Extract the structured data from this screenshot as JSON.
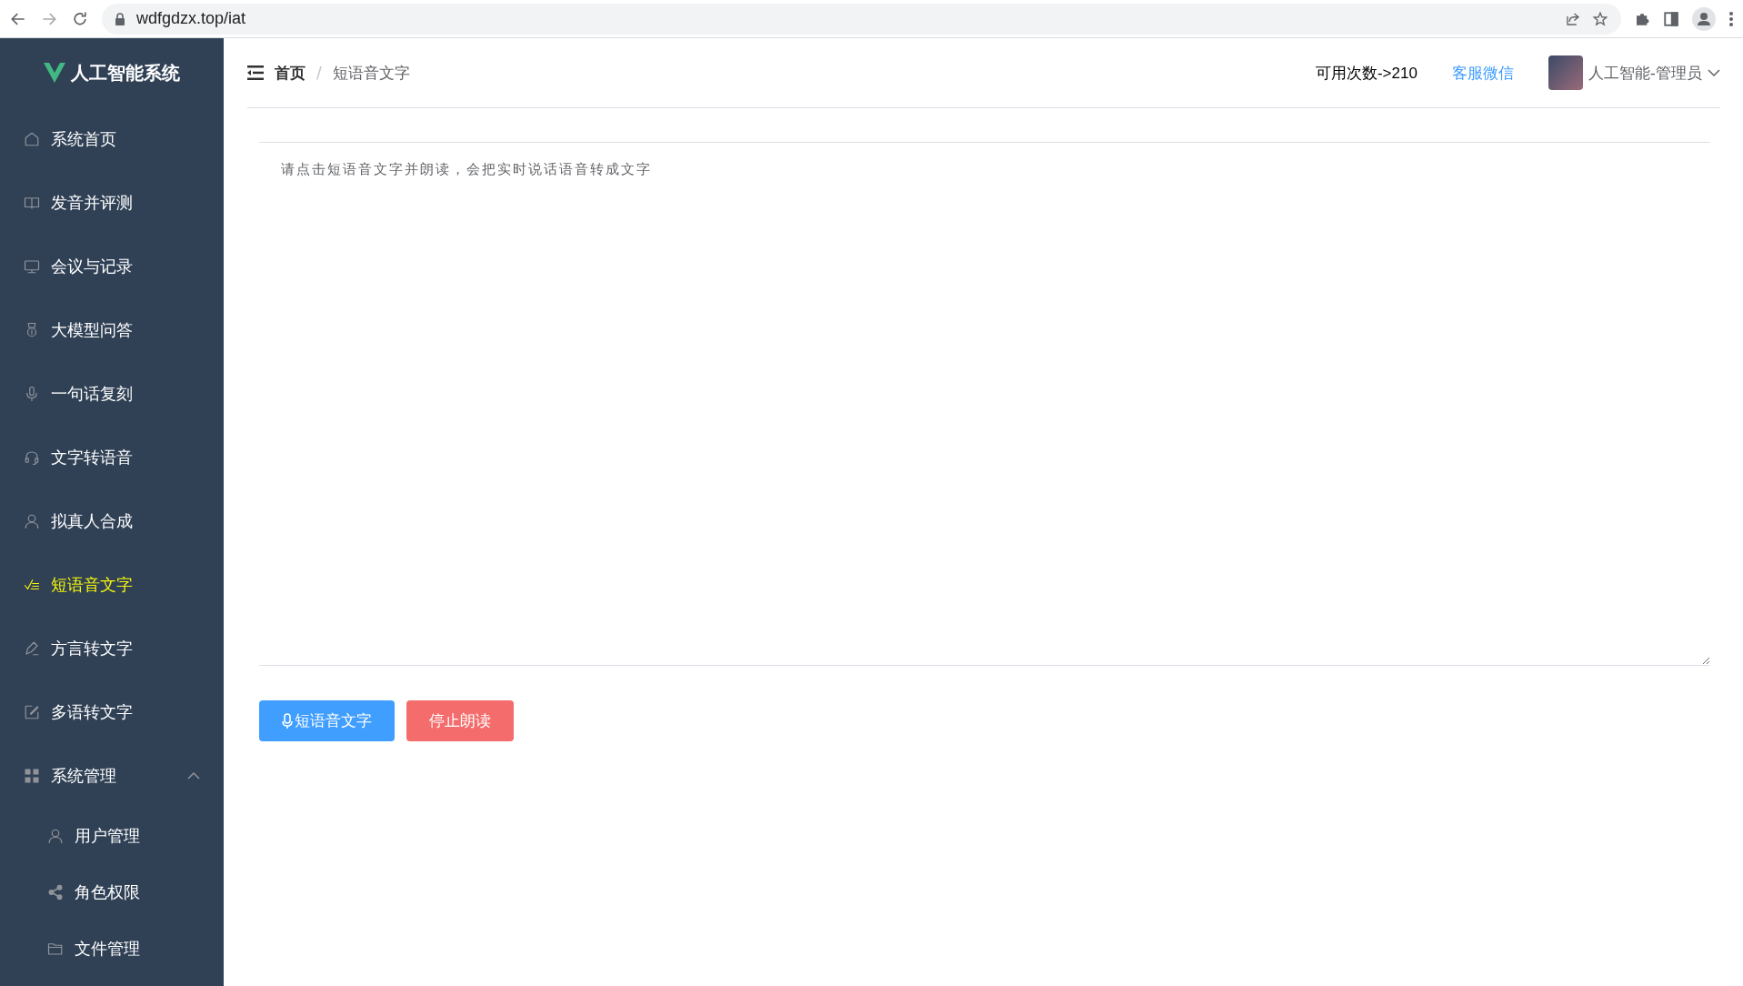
{
  "browser": {
    "url": "wdfgdzx.top/iat"
  },
  "sidebar": {
    "title": "人工智能系统",
    "items": [
      {
        "label": "系统首页",
        "kind": "home",
        "selected": false
      },
      {
        "label": "发音并评测",
        "kind": "book",
        "selected": false
      },
      {
        "label": "会议与记录",
        "kind": "monitor",
        "selected": false
      },
      {
        "label": "大模型问答",
        "kind": "medal",
        "selected": false
      },
      {
        "label": "一句话复刻",
        "kind": "mic",
        "selected": false
      },
      {
        "label": "文字转语音",
        "kind": "headset",
        "selected": false
      },
      {
        "label": "拟真人合成",
        "kind": "user",
        "selected": false
      },
      {
        "label": "短语音文字",
        "kind": "check",
        "selected": true
      },
      {
        "label": "方言转文字",
        "kind": "pen",
        "selected": false
      },
      {
        "label": "多语转文字",
        "kind": "edit",
        "selected": false
      },
      {
        "label": "系统管理",
        "kind": "grid",
        "selected": false,
        "expanded": true,
        "children": [
          {
            "label": "用户管理",
            "kind": "user",
            "selected": false
          },
          {
            "label": "角色权限",
            "kind": "share",
            "selected": false
          },
          {
            "label": "文件管理",
            "kind": "folder",
            "selected": false
          }
        ]
      }
    ]
  },
  "header": {
    "breadcrumb": [
      "首页",
      "短语音文字"
    ],
    "breadcrumb_separator": "/",
    "quota": "可用次数->210",
    "service_link": "客服微信",
    "user": "人工智能-管理员"
  },
  "input": {
    "placeholder": "请点击短语音文字并朗读，会把实时说话语音转成文字"
  },
  "buttons": [
    {
      "label": "短语音文字",
      "kind": "primary"
    },
    {
      "label": "停止朗读",
      "kind": "danger"
    }
  ]
}
